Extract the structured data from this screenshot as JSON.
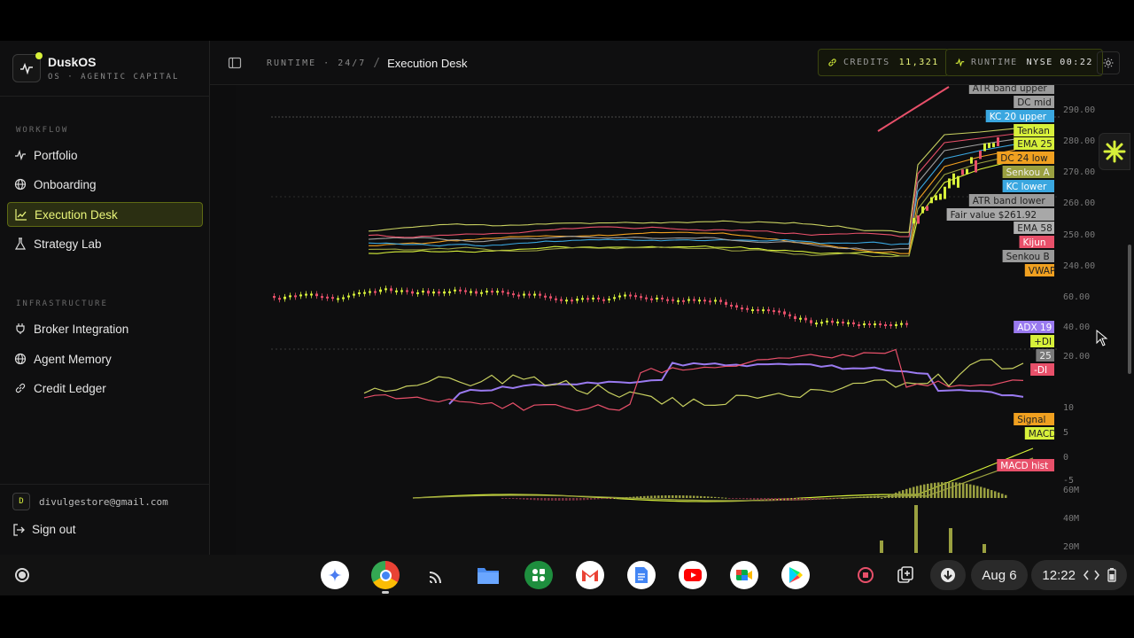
{
  "sidebar": {
    "brand": {
      "name": "DuskOS",
      "subtitle": "OS · AGENTIC CAPITAL"
    },
    "sections": [
      {
        "label": "WORKFLOW"
      },
      {
        "label": "INFRASTRUCTURE"
      }
    ],
    "items": [
      {
        "label": "Portfolio",
        "icon": "activity-icon",
        "active": false
      },
      {
        "label": "Onboarding",
        "icon": "globe-icon",
        "active": false
      },
      {
        "label": "Execution Desk",
        "icon": "line-chart-icon",
        "active": true
      },
      {
        "label": "Strategy Lab",
        "icon": "flask-icon",
        "active": false
      },
      {
        "label": "Broker Integration",
        "icon": "plug-icon",
        "active": false
      },
      {
        "label": "Agent Memory",
        "icon": "globe-icon",
        "active": false
      },
      {
        "label": "Credit Ledger",
        "icon": "link-icon",
        "active": false
      }
    ],
    "user": {
      "initial": "D",
      "email": "divulgestore@gmail.com"
    },
    "signout_label": "Sign out"
  },
  "header": {
    "breadcrumb": {
      "root": "RUNTIME · 24/7",
      "separator": "/",
      "current": "Execution Desk"
    },
    "credits": {
      "label": "CREDITS",
      "value": "11,321"
    },
    "runtime": {
      "label": "RUNTIME",
      "value": "NYSE 00:22"
    }
  },
  "chart": {
    "price_axis": [
      "290.00",
      "280.00",
      "270.00",
      "260.00",
      "250.00",
      "240.00"
    ],
    "adx_axis": [
      "60.00",
      "40.00",
      "20.00"
    ],
    "macd_axis": [
      "10",
      "5",
      "0",
      "-5"
    ],
    "volume_axis": [
      "60M",
      "40M",
      "20M"
    ],
    "price_labels": [
      {
        "text": "ATR band upper",
        "bg": "#9a9a9a",
        "fg": "#222222"
      },
      {
        "text": "DC mid",
        "bg": "#a0a0a0",
        "fg": "#222222"
      },
      {
        "text": "KC 20 upper",
        "bg": "#3aa7e0",
        "fg": "#ffffff"
      },
      {
        "text": "Tenkan",
        "bg": "#d7f03a",
        "fg": "#222222"
      },
      {
        "text": "EMA 25",
        "bg": "#d7f03a",
        "fg": "#222222"
      },
      {
        "text": "DC 24 low",
        "bg": "#f0a020",
        "fg": "#222222"
      },
      {
        "text": "Senkou A",
        "bg": "#9aa040",
        "fg": "#eeeeee"
      },
      {
        "text": "KC lower",
        "bg": "#3aa7e0",
        "fg": "#ffffff"
      },
      {
        "text": "ATR band lower",
        "bg": "#9a9a9a",
        "fg": "#222222"
      },
      {
        "text": "Fair value $261.92",
        "bg": "#a8a8a8",
        "fg": "#222222"
      },
      {
        "text": "EMA 58",
        "bg": "#b0b0b0",
        "fg": "#222222"
      },
      {
        "text": "Kijun",
        "bg": "#e8506a",
        "fg": "#ffffff"
      },
      {
        "text": "Senkou B",
        "bg": "#9a9a9a",
        "fg": "#222222"
      },
      {
        "text": "VWAP",
        "bg": "#f0a020",
        "fg": "#222222"
      }
    ],
    "adx_labels": [
      {
        "text": "ADX 19",
        "bg": "#9a7af0",
        "fg": "#ffffff"
      },
      {
        "text": "+DI",
        "bg": "#d7f03a",
        "fg": "#222222"
      },
      {
        "text": "25",
        "bg": "#7a7a7a",
        "fg": "#eeeeee"
      },
      {
        "text": "-DI",
        "bg": "#e8506a",
        "fg": "#ffffff"
      }
    ],
    "macd_labels": [
      {
        "text": "Signal",
        "bg": "#f0a020",
        "fg": "#222222"
      },
      {
        "text": "MACD",
        "bg": "#d7f03a",
        "fg": "#222222"
      },
      {
        "text": "MACD hist",
        "bg": "#e8506a",
        "fg": "#ffffff"
      }
    ]
  },
  "taskbar": {
    "date": "Aug 6",
    "time": "12:22",
    "apps": [
      "gemini-icon",
      "chrome-icon",
      "cast-icon",
      "files-icon",
      "apps-icon",
      "gmail-icon",
      "docs-icon",
      "youtube-icon",
      "meet-icon",
      "play-store-icon"
    ]
  },
  "colors": {
    "accent": "#d7f03a",
    "danger": "#e8506a",
    "info": "#3aa7e0",
    "warn": "#f0a020",
    "purple": "#9a7af0"
  }
}
